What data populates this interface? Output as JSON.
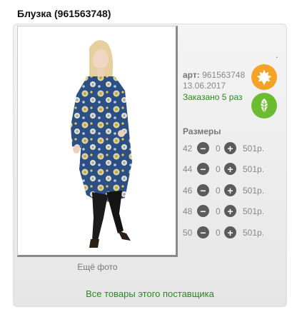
{
  "product": {
    "title": "Блузка (961563748)",
    "art_label": "арт:",
    "art_value": "961563748",
    "date": "13.06.2017",
    "ordered": "Заказано 5 раз",
    "dot": "."
  },
  "photo": {
    "more_label": "Ещё фото"
  },
  "sizes": {
    "title": "Размеры",
    "rows": [
      {
        "size": "42",
        "qty": "0",
        "price": "501р."
      },
      {
        "size": "44",
        "qty": "0",
        "price": "501р."
      },
      {
        "size": "46",
        "qty": "0",
        "price": "501р."
      },
      {
        "size": "48",
        "qty": "0",
        "price": "501р."
      },
      {
        "size": "50",
        "qty": "0",
        "price": "501р."
      }
    ]
  },
  "footer": {
    "supplier_link": "Все товары этого поставщика"
  },
  "icons": {
    "orange_leaf": "maple-leaf-icon",
    "green_leaf": "leaf-icon",
    "minus": "minus-icon",
    "plus": "plus-icon"
  },
  "colors": {
    "orange": "#f5a327",
    "green": "#6cbc31",
    "link_green": "#2a8a1f",
    "button_dark": "#5b5b5b"
  }
}
